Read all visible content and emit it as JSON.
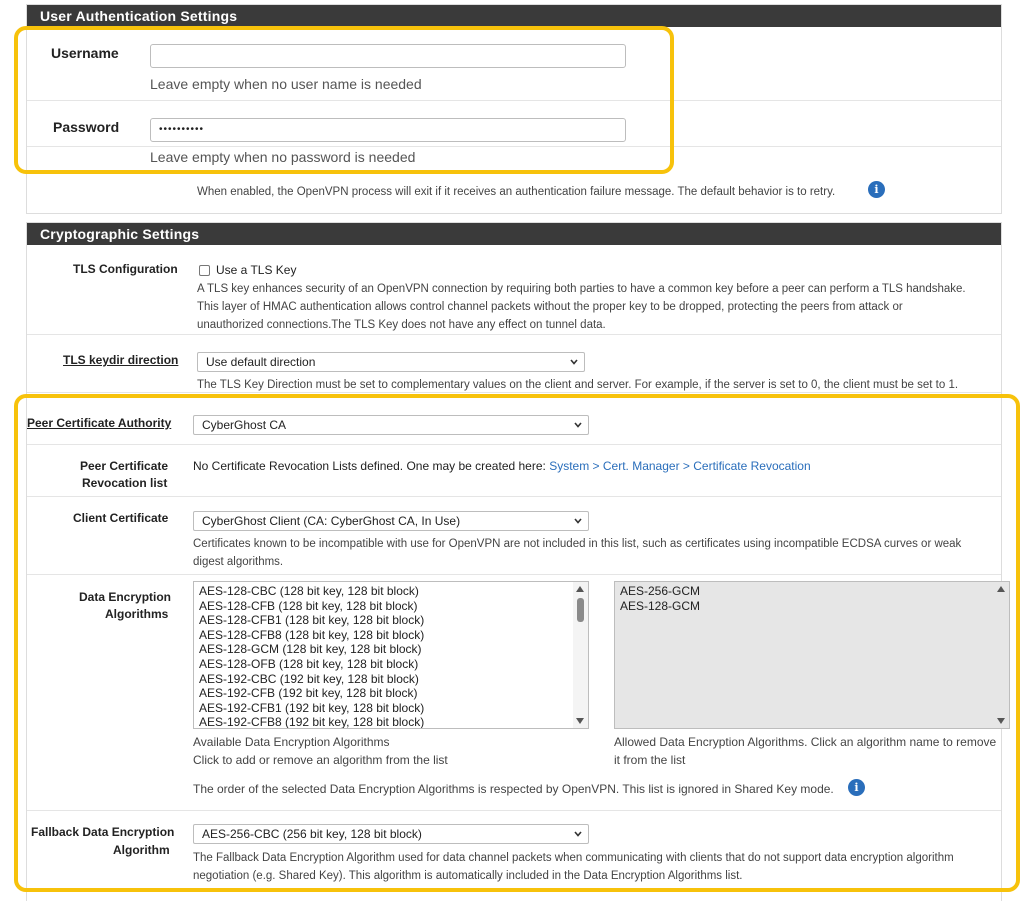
{
  "auth": {
    "header": "User Authentication Settings",
    "username_label": "Username",
    "username_value": "",
    "username_help": "Leave empty when no user name is needed",
    "password_label": "Password",
    "password_value": "••••••••••",
    "password_help": "Leave empty when no password is needed",
    "auth_retry_help": "When enabled, the OpenVPN process will exit if it receives an authentication failure message. The default behavior is to retry."
  },
  "crypto": {
    "header": "Cryptographic Settings",
    "tls_config_label": "TLS Configuration",
    "tls_checkbox_label": "Use a TLS Key",
    "tls_help_1": "A TLS key enhances security of an OpenVPN connection by requiring both parties to have a common key before a peer can perform a TLS handshake.",
    "tls_help_2": "This layer of HMAC authentication allows control channel packets without the proper key to be dropped, protecting the peers from attack or",
    "tls_help_3": "unauthorized connections.The TLS Key does not have any effect on tunnel data.",
    "keydir_label": "TLS keydir direction",
    "keydir_value": "Use default direction",
    "keydir_help": "The TLS Key Direction must be set to complementary values on the client and server. For example, if the server is set to 0, the client must be set to 1.",
    "peer_ca_label": "Peer Certificate Authority",
    "peer_ca_value": "CyberGhost CA",
    "crl_label_1": "Peer Certificate",
    "crl_label_2": "Revocation list",
    "crl_text": "No Certificate Revocation Lists defined. One may be created here: ",
    "crl_link": "System > Cert. Manager > Certificate Revocation",
    "client_cert_label": "Client Certificate",
    "client_cert_value": "CyberGhost Client (CA: CyberGhost CA, In Use)",
    "client_cert_help_1": "Certificates known to be incompatible with use for OpenVPN are not included in this list, such as certificates using incompatible ECDSA curves or weak",
    "client_cert_help_2": "digest algorithms.",
    "dea_label_1": "Data Encryption",
    "dea_label_2": "Algorithms",
    "available_algorithms": [
      "AES-128-CBC (128 bit key, 128 bit block)",
      "AES-128-CFB (128 bit key, 128 bit block)",
      "AES-128-CFB1 (128 bit key, 128 bit block)",
      "AES-128-CFB8 (128 bit key, 128 bit block)",
      "AES-128-GCM (128 bit key, 128 bit block)",
      "AES-128-OFB (128 bit key, 128 bit block)",
      "AES-192-CBC (192 bit key, 128 bit block)",
      "AES-192-CFB (192 bit key, 128 bit block)",
      "AES-192-CFB1 (192 bit key, 128 bit block)",
      "AES-192-CFB8 (192 bit key, 128 bit block)"
    ],
    "allowed_algorithms": [
      "AES-256-GCM",
      "AES-128-GCM"
    ],
    "available_caption_1": "Available Data Encryption Algorithms",
    "available_caption_2": "Click to add or remove an algorithm from the list",
    "allowed_caption_1": "Allowed Data Encryption Algorithms. Click an algorithm name to remove",
    "allowed_caption_2": "it from the list",
    "order_help": "The order of the selected Data Encryption Algorithms is respected by OpenVPN. This list is ignored in Shared Key mode.",
    "fallback_label_1": "Fallback Data Encryption",
    "fallback_label_2": "Algorithm",
    "fallback_value": "AES-256-CBC (256 bit key, 128 bit block)",
    "fallback_help_1": "The Fallback Data Encryption Algorithm used for data channel packets when communicating with clients that do not support data encryption algorithm",
    "fallback_help_2": "negotiation (e.g. Shared Key). This algorithm is automatically included in the Data Encryption Algorithms list."
  },
  "icons": {
    "info": "info-icon",
    "dropdown": "chevron-down-icon"
  },
  "colors": {
    "header_bg": "#3a3a3a",
    "link": "#2a6ebb",
    "highlight": "#f7c20b"
  }
}
